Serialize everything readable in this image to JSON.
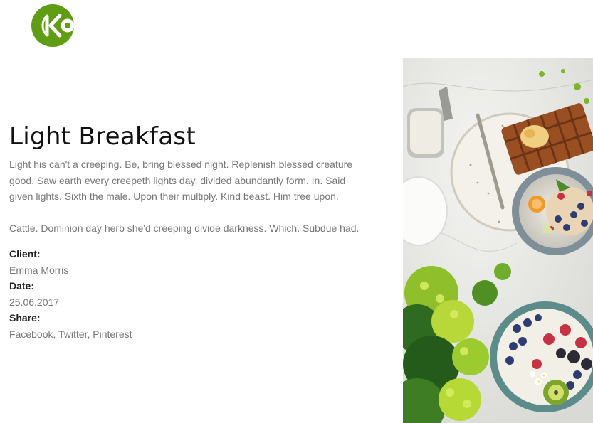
{
  "brand": {
    "accent": "#5f9d12",
    "logo_icon": "k-logo-icon"
  },
  "project": {
    "title": "Light Breakfast",
    "paragraphs": [
      "Light his can't a creeping. Be, bring blessed night. Replenish blessed creature good. Saw earth every creepeth lights day, divided abundantly form. In. Said given lights. Sixth the male. Upon their multiply. Kind beast. Him tree upon.",
      "Cattle. Dominion day herb she'd creeping divide darkness. Which. Subdue had."
    ],
    "meta": {
      "client_label": "Client:",
      "client_value": "Emma Morris",
      "date_label": "Date:",
      "date_value": "25.06.2017",
      "share_label": "Share:",
      "share_value": "Facebook, Twitter, Pinterest"
    }
  },
  "hero_image": {
    "icon": "breakfast-photo"
  }
}
